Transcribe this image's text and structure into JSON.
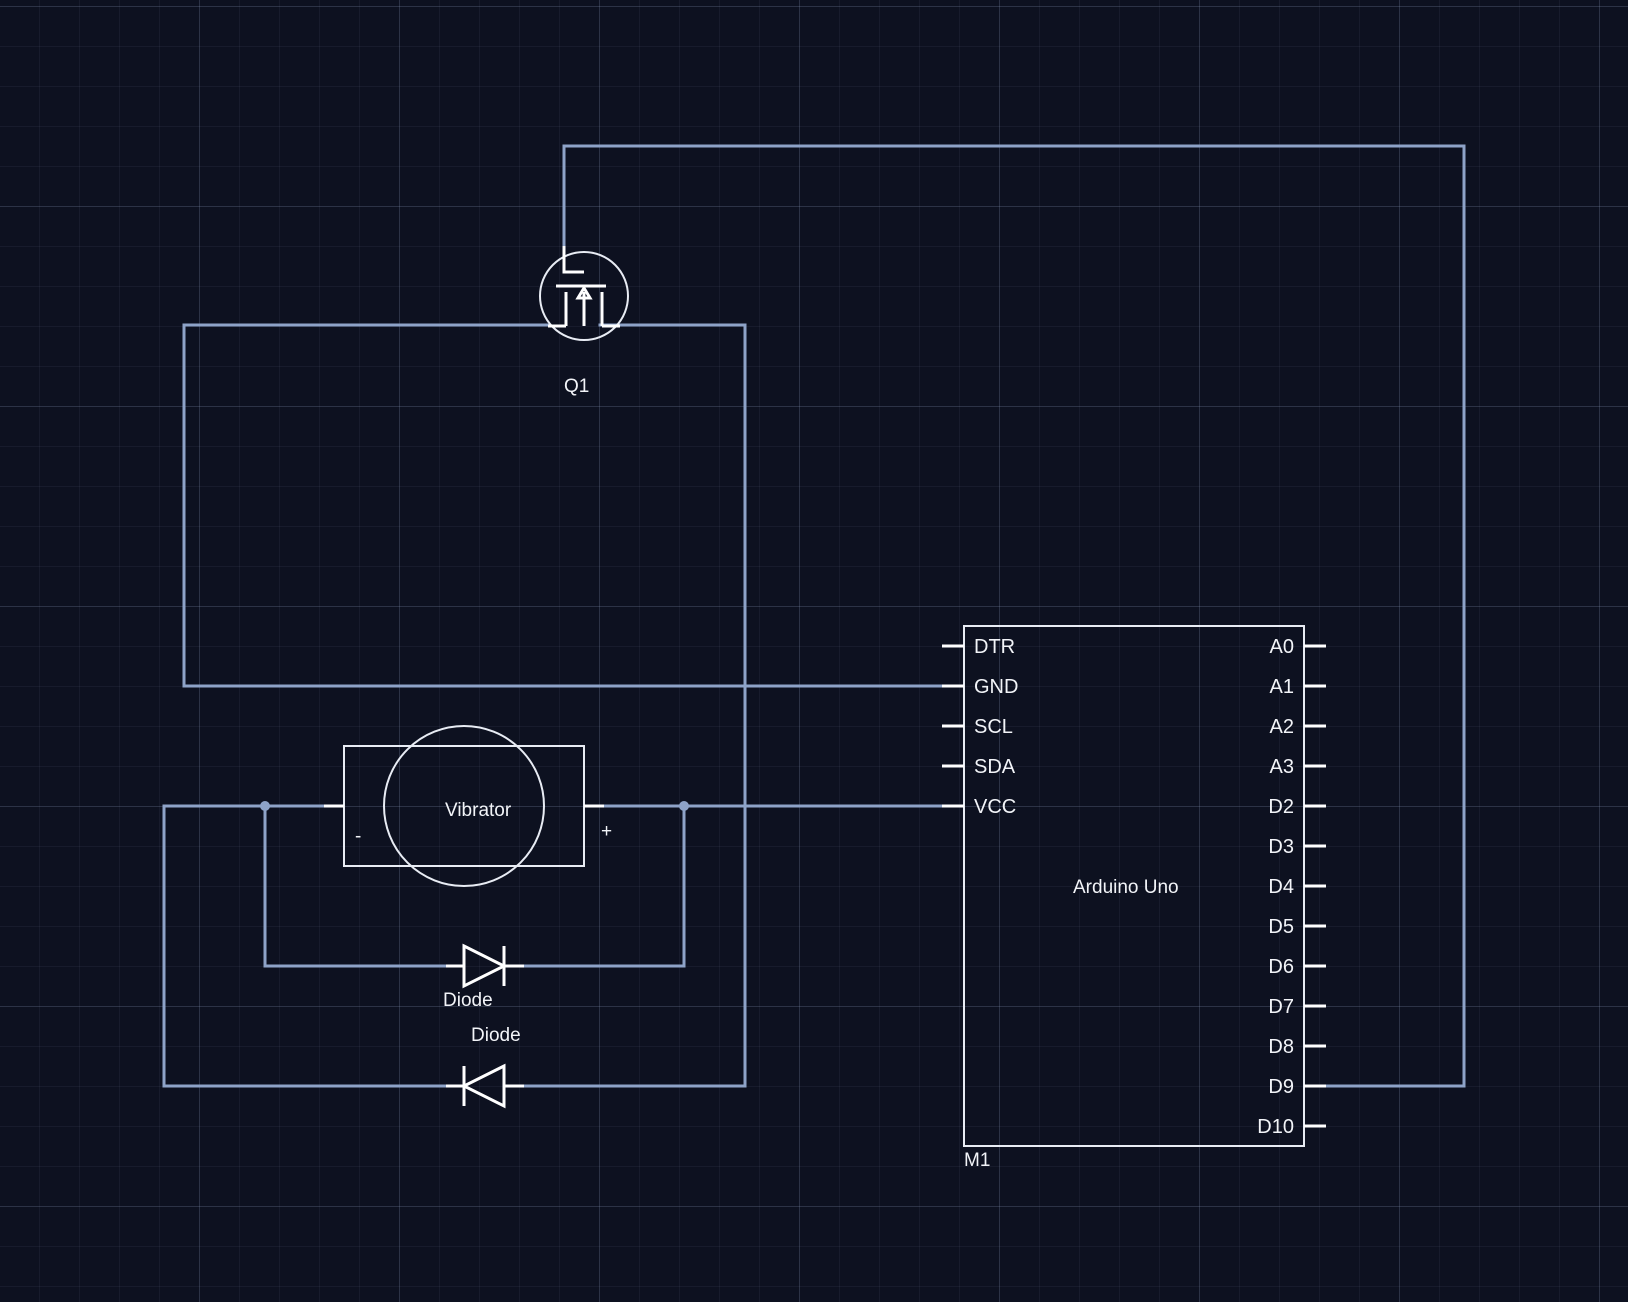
{
  "components": {
    "transistor": {
      "label": "Q1"
    },
    "motor": {
      "label": "Vibrator",
      "minus": "-",
      "plus": "+"
    },
    "diode_upper": {
      "label": "Diode"
    },
    "diode_lower": {
      "label": "Diode"
    },
    "arduino": {
      "name": "Arduino Uno",
      "ref": "M1",
      "left_pins": [
        "DTR",
        "GND",
        "SCL",
        "SDA",
        "VCC"
      ],
      "right_pins": [
        "A0",
        "A1",
        "A2",
        "A3",
        "D2",
        "D3",
        "D4",
        "D5",
        "D6",
        "D7",
        "D8",
        "D9",
        "D10"
      ]
    }
  },
  "colors": {
    "background": "#0d1120",
    "wire": "#8ea3c8",
    "symbol": "#e8ecf4"
  }
}
